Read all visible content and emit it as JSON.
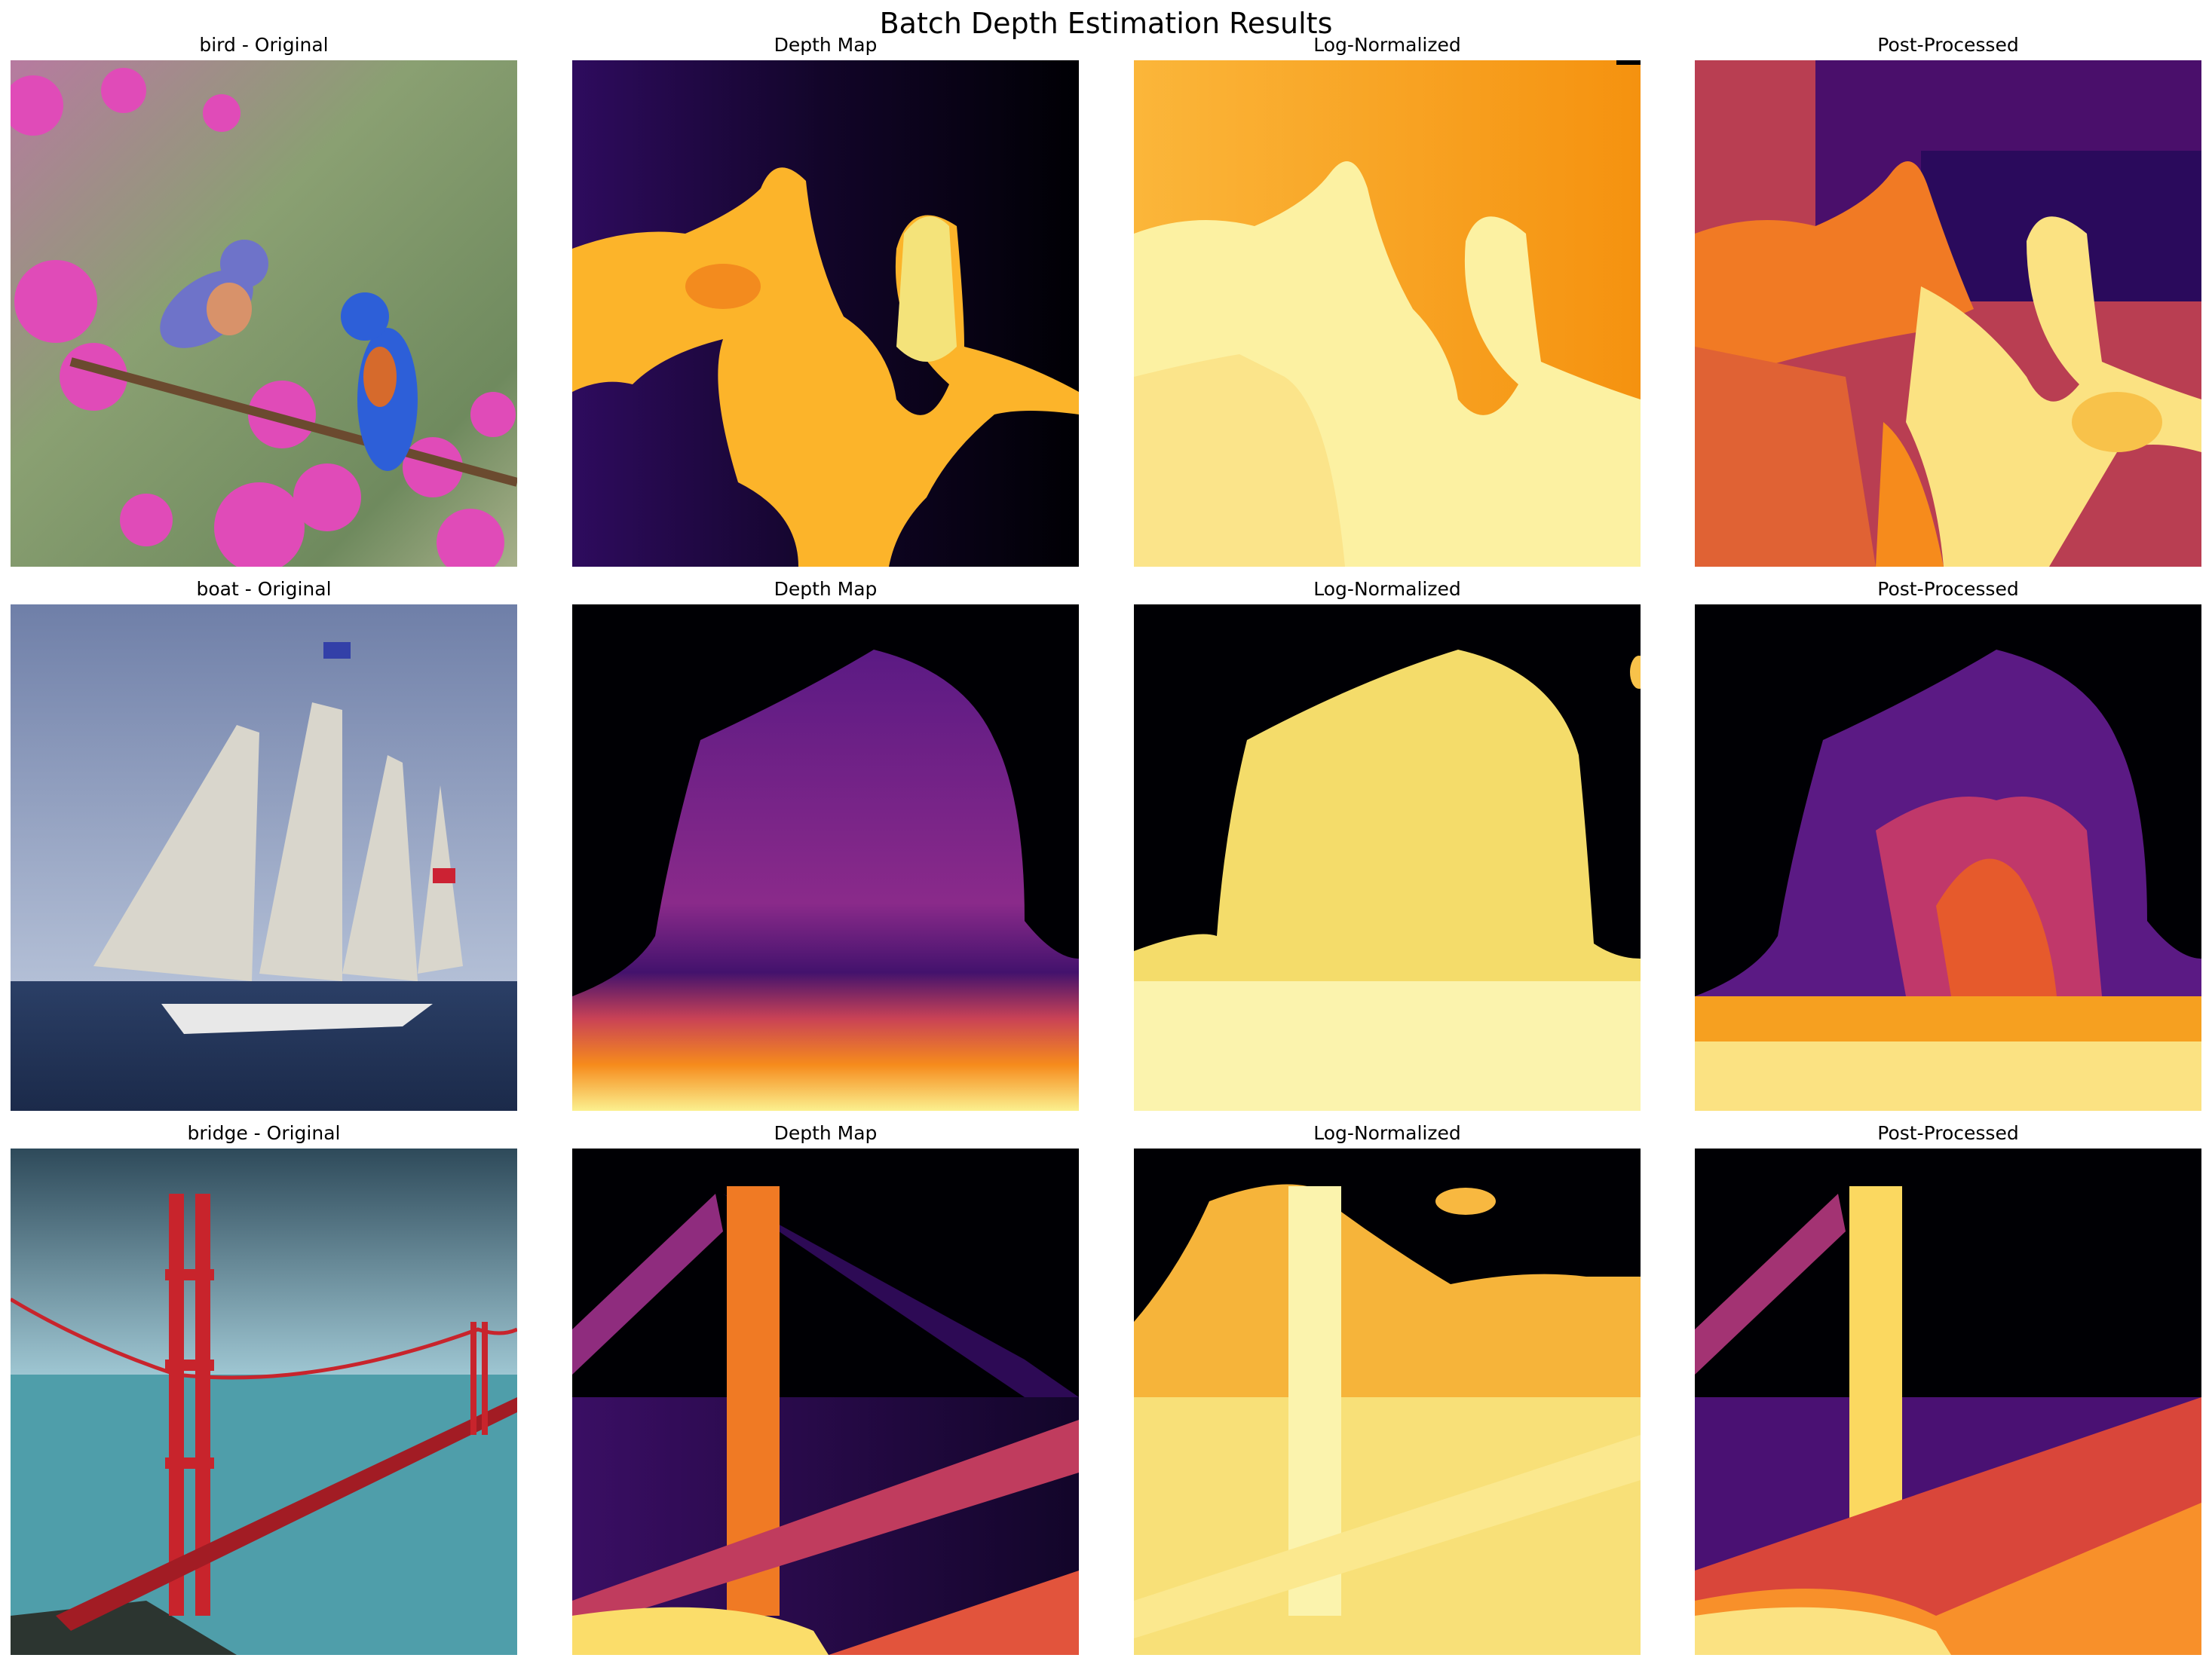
{
  "figure": {
    "title": "Batch Depth Estimation Results"
  },
  "rows": [
    {
      "name": "bird",
      "titles": [
        "bird - Original",
        "Depth Map",
        "Log-Normalized",
        "Post-Processed"
      ]
    },
    {
      "name": "boat",
      "titles": [
        "boat - Original",
        "Depth Map",
        "Log-Normalized",
        "Post-Processed"
      ]
    },
    {
      "name": "bridge",
      "titles": [
        "bridge - Original",
        "Depth Map",
        "Log-Normalized",
        "Post-Processed"
      ]
    }
  ],
  "colormap": "inferno"
}
